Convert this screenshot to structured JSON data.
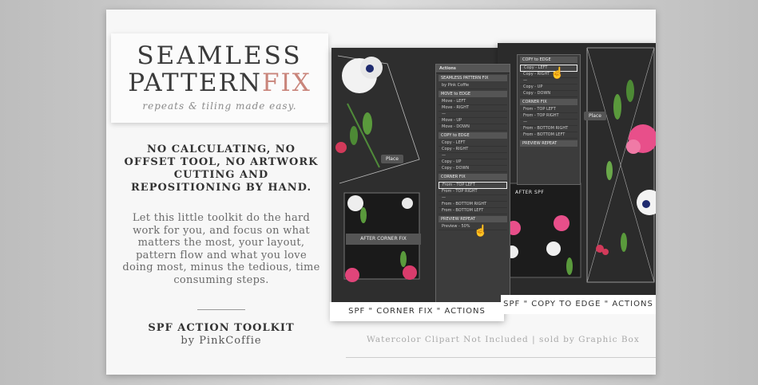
{
  "title": {
    "line1": "SEAMLESS",
    "line2a": "PATTERN",
    "line2b": "FIX",
    "tagline": "repeats & tiling made easy."
  },
  "lead": "NO CALCULATING, NO OFFSET TOOL, NO ARTWORK CUTTING AND REPOSITIONING BY HAND.",
  "body": "Let this little toolkit do the hard work for you, and focus on what matters the most, your layout, pattern flow and what you love doing most, minus the tedious, time consuming steps.",
  "kit": {
    "name": "SPF ACTION TOOLKIT",
    "by": "by PinkCoffie"
  },
  "captions": {
    "corner": "SPF \" CORNER FIX \" ACTIONS",
    "edge": "SPF \" COPY TO EDGE \" ACTIONS"
  },
  "credit": "Watercolor Clipart Not Included | sold by Graphic Box",
  "panel_labels": {
    "after_corner": "AFTER CORNER FIX",
    "after_spf": "AFTER SPF",
    "place": "Place"
  },
  "actions1": {
    "header": "Actions",
    "items": [
      {
        "t": "sect",
        "v": "SEAMLESS PATTERN FIX"
      },
      {
        "t": "row",
        "v": "by Pink Coffie"
      },
      {
        "t": "sect",
        "v": "MOVE to EDGE"
      },
      {
        "t": "row",
        "v": "Move  -  LEFT"
      },
      {
        "t": "row",
        "v": "Move  -  RIGHT"
      },
      {
        "t": "row",
        "v": "—"
      },
      {
        "t": "row",
        "v": "Move  -  UP"
      },
      {
        "t": "row",
        "v": "Move  -  DOWN"
      },
      {
        "t": "sect",
        "v": "COPY to EDGE"
      },
      {
        "t": "row",
        "v": "Copy  -  LEFT"
      },
      {
        "t": "row",
        "v": "Copy  -  RIGHT"
      },
      {
        "t": "row",
        "v": "—"
      },
      {
        "t": "row",
        "v": "Copy  -  UP"
      },
      {
        "t": "row",
        "v": "Copy  -  DOWN"
      },
      {
        "t": "sect",
        "v": "CORNER FIX"
      },
      {
        "t": "hl",
        "v": "From  -  TOP LEFT"
      },
      {
        "t": "row",
        "v": "From  -  TOP RIGHT"
      },
      {
        "t": "row",
        "v": "—"
      },
      {
        "t": "row",
        "v": "From  -  BOTTOM RIGHT"
      },
      {
        "t": "row",
        "v": "From  -  BOTTOM LEFT"
      },
      {
        "t": "sect",
        "v": "PREVIEW REPEAT"
      },
      {
        "t": "row",
        "v": "Preview  -  50%"
      }
    ]
  },
  "actions2": {
    "items": [
      {
        "t": "sect",
        "v": "COPY to EDGE"
      },
      {
        "t": "hl",
        "v": "Copy  -  LEFT"
      },
      {
        "t": "row",
        "v": "Copy  -  RIGHT"
      },
      {
        "t": "row",
        "v": "—"
      },
      {
        "t": "row",
        "v": "Copy  -  UP"
      },
      {
        "t": "row",
        "v": "Copy  -  DOWN"
      },
      {
        "t": "sect",
        "v": "CORNER FIX"
      },
      {
        "t": "row",
        "v": "From  -  TOP LEFT"
      },
      {
        "t": "row",
        "v": "From  -  TOP RIGHT"
      },
      {
        "t": "row",
        "v": "—"
      },
      {
        "t": "row",
        "v": "From  -  BOTTOM RIGHT"
      },
      {
        "t": "row",
        "v": "From  -  BOTTOM LEFT"
      },
      {
        "t": "sect",
        "v": "PREVIEW REPEAT"
      }
    ]
  }
}
